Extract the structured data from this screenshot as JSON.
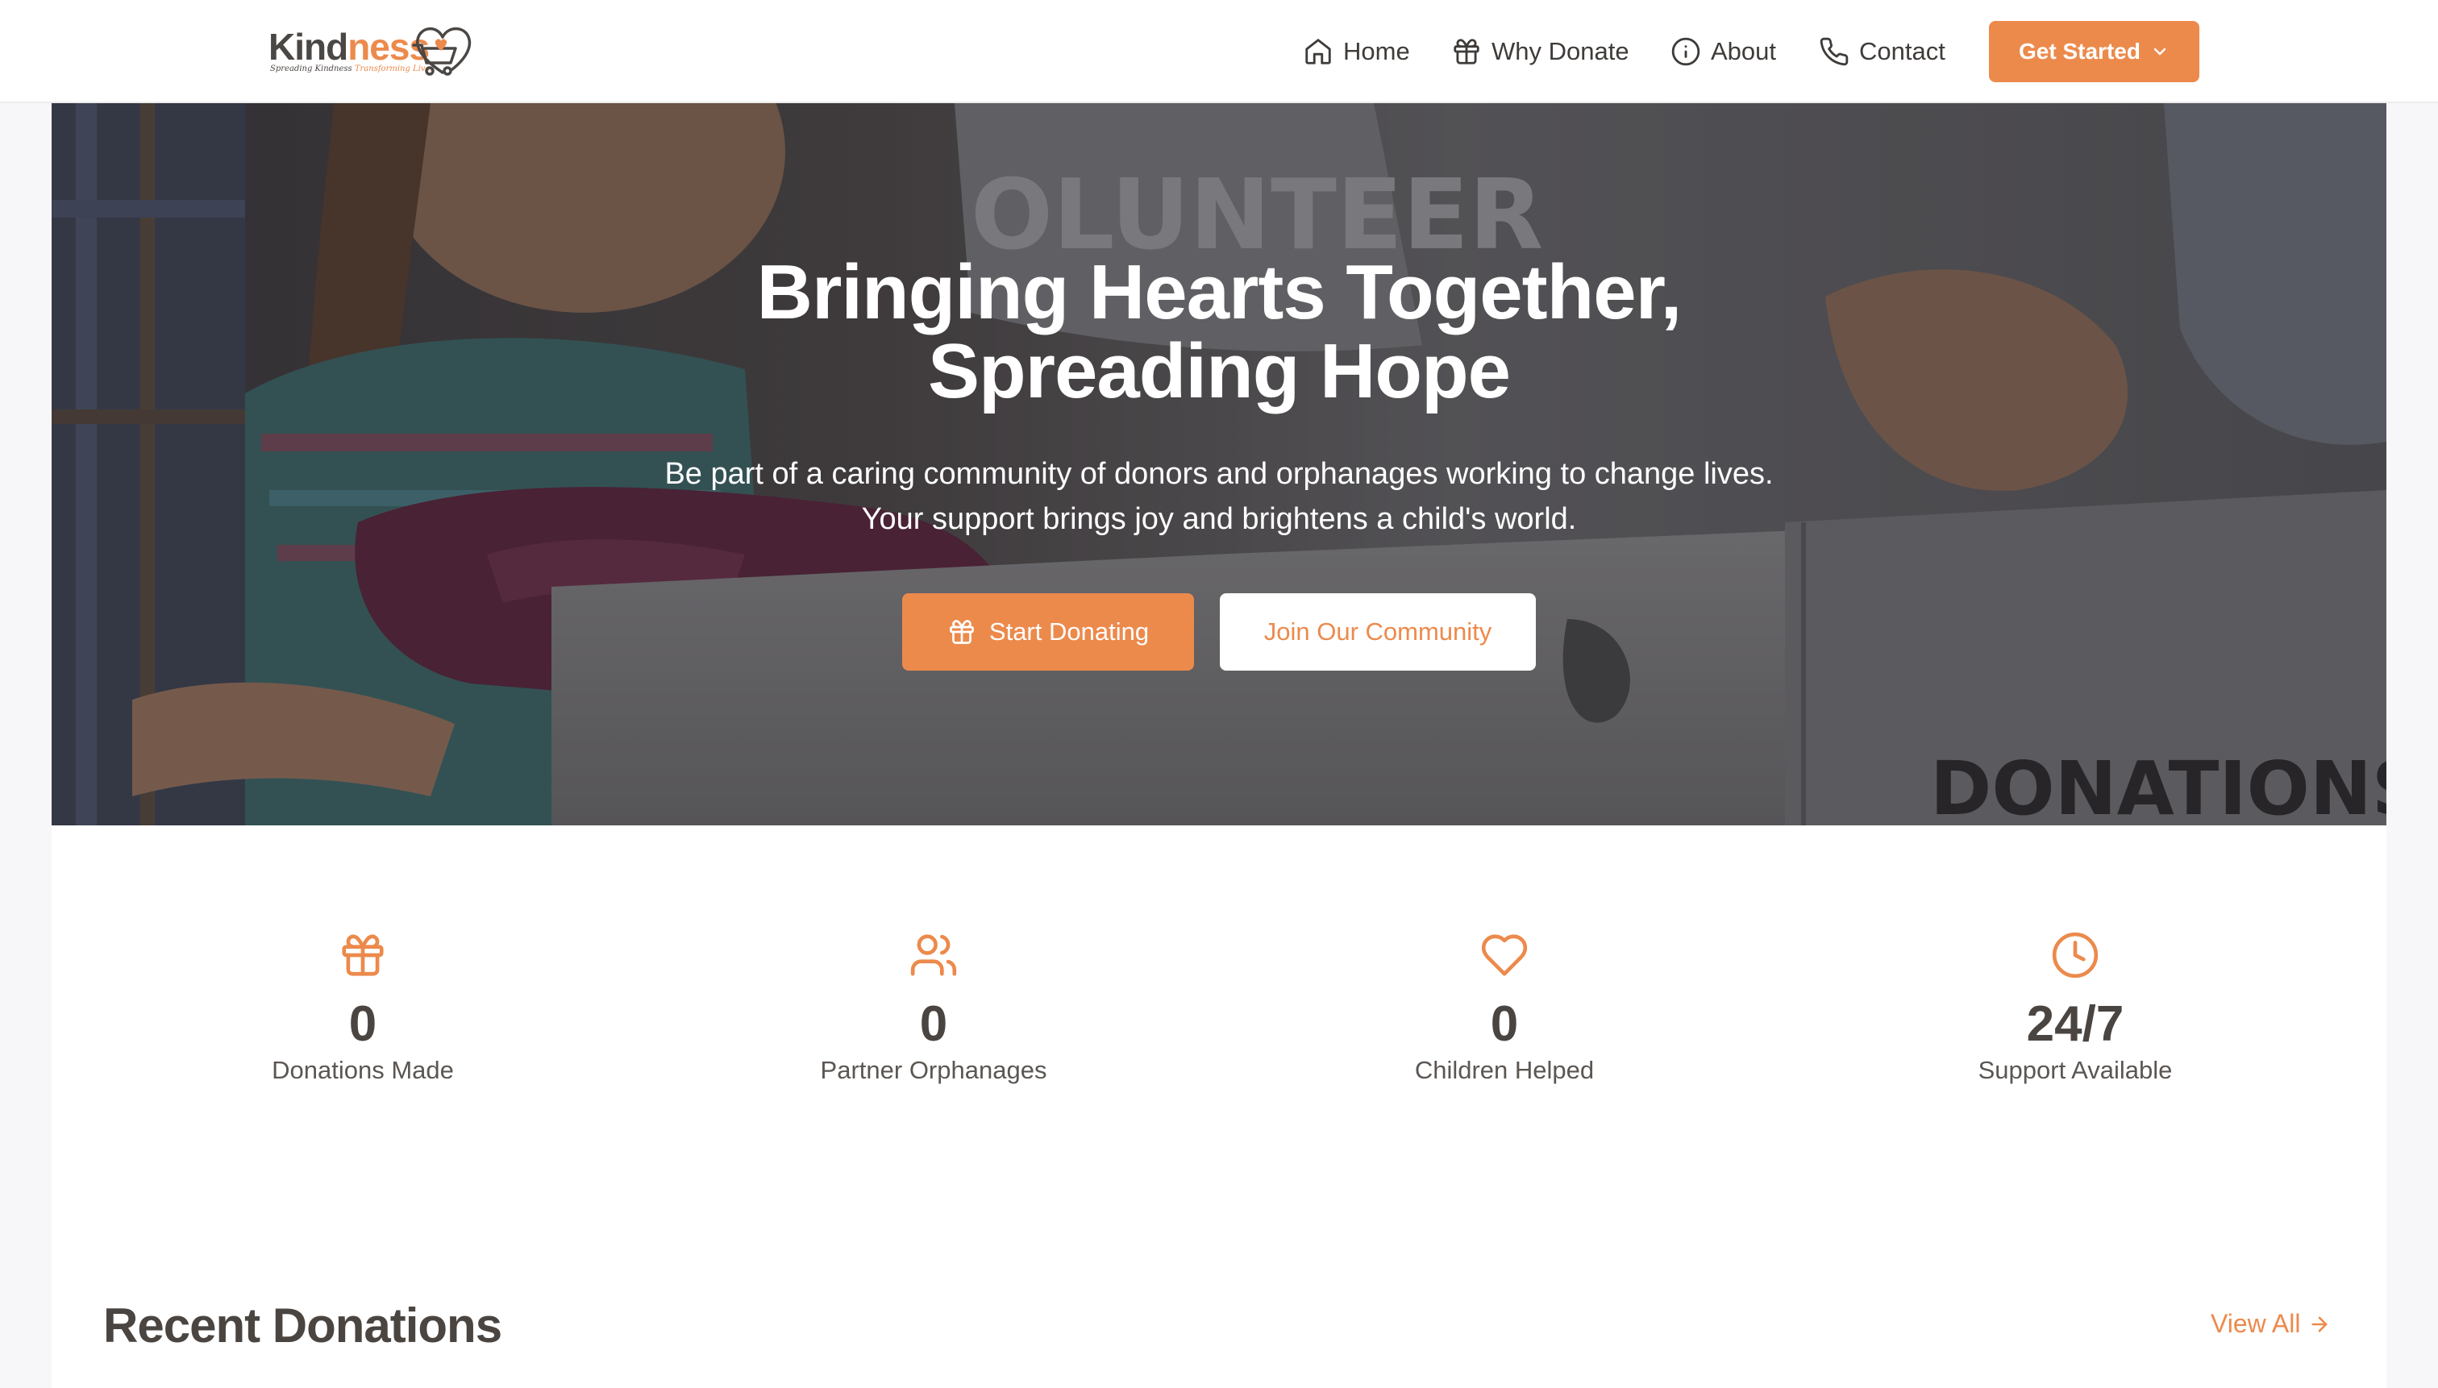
{
  "header": {
    "logo": {
      "word_a": "Kind",
      "word_b": "ness",
      "tagline_a": "Spreading Kindness",
      "tagline_b": "Transforming Lives"
    },
    "nav": [
      {
        "label": "Home",
        "icon": "home-icon"
      },
      {
        "label": "Why Donate",
        "icon": "gift-icon"
      },
      {
        "label": "About",
        "icon": "info-icon"
      },
      {
        "label": "Contact",
        "icon": "phone-icon"
      }
    ],
    "cta": {
      "label": "Get Started",
      "icon": "chevron-down-icon"
    }
  },
  "hero": {
    "title_line1": "Bringing Hearts Together,",
    "title_line2": "Spreading Hope",
    "subtitle": "Be part of a caring community of donors and orphanages working to change lives. Your support brings joy and brightens a child's world.",
    "primary_button": "Start Donating",
    "secondary_button": "Join Our Community",
    "background_sign_text": "DONATIONS",
    "background_shirt_text": "OLUNTEER"
  },
  "stats": [
    {
      "icon": "gift-icon",
      "value": "0",
      "label": "Donations Made"
    },
    {
      "icon": "users-icon",
      "value": "0",
      "label": "Partner Orphanages"
    },
    {
      "icon": "heart-icon",
      "value": "0",
      "label": "Children Helped"
    },
    {
      "icon": "clock-icon",
      "value": "24/7",
      "label": "Support Available"
    }
  ],
  "recent": {
    "title": "Recent Donations",
    "view_all": "View All"
  },
  "colors": {
    "accent": "#ec8a4c",
    "text": "#4a4541",
    "page_bg": "#f7f7f9"
  }
}
